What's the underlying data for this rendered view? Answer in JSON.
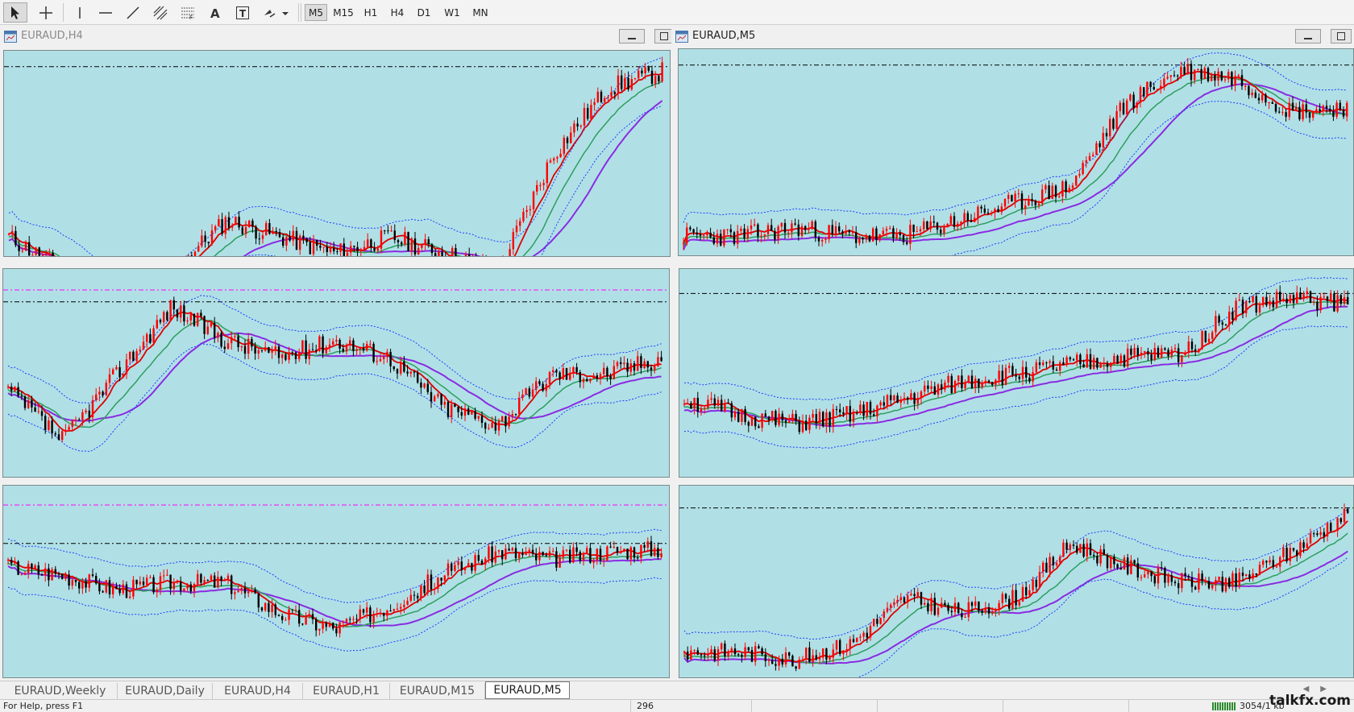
{
  "toolbar": {
    "tools": [
      "cursor-arrow-icon",
      "crosshair-icon",
      "vertical-line-icon",
      "horizontal-line-icon",
      "trend-line-icon",
      "equidistant-channel-icon",
      "fibonacci-icon",
      "text-icon",
      "text-label-icon",
      "arrows-icon"
    ],
    "timeframes": [
      "M5",
      "M15",
      "H1",
      "H4",
      "D1",
      "W1",
      "MN"
    ],
    "active_timeframe": "M5"
  },
  "charts": [
    {
      "title": "EURAUD,H4",
      "active": false
    },
    {
      "title": "EURAUD,M5",
      "active": true
    },
    {
      "title": "",
      "active": false
    },
    {
      "title": "",
      "active": false
    },
    {
      "title": "",
      "active": false
    },
    {
      "title": "",
      "active": false
    }
  ],
  "tabs": [
    "EURAUD,Weekly",
    "EURAUD,Daily",
    "EURAUD,H4",
    "EURAUD,H1",
    "EURAUD,M15",
    "EURAUD,M5"
  ],
  "active_tab": "EURAUD,M5",
  "status": {
    "left": "For Help, press F1",
    "middle": "296",
    "right": "3054/1 kb"
  },
  "watermark": "talkfx.com",
  "colors": {
    "plot_bg": "#b0e0e6",
    "bull": "#ff0000",
    "bear": "#000000",
    "ma_fast": "#e00000",
    "ma_mid": "#2e9e5e",
    "ma_slow": "#8a2be2",
    "band": "#1e3cff",
    "level": "#000000",
    "level2": "#ff00ff"
  }
}
